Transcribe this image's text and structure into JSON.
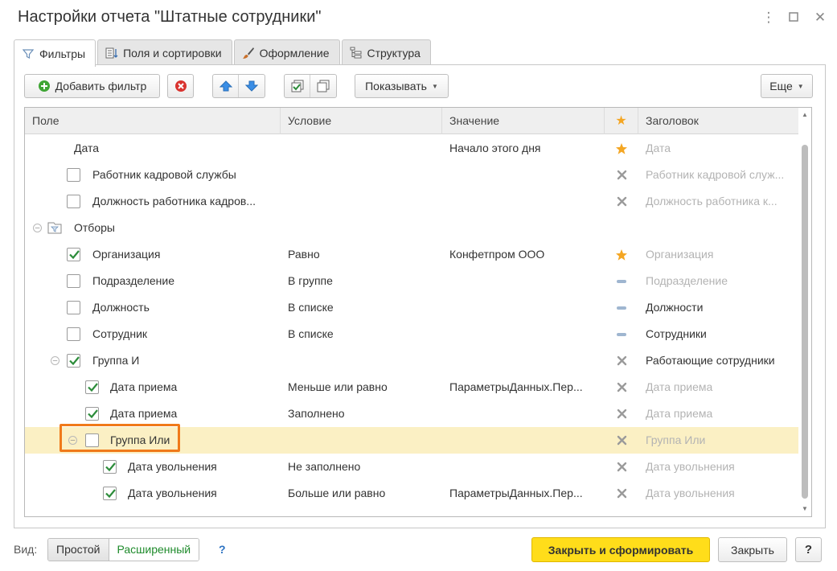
{
  "window": {
    "title": "Настройки отчета \"Штатные сотрудники\""
  },
  "tabs": [
    {
      "label": "Фильтры",
      "icon": "filter-icon",
      "active": true
    },
    {
      "label": "Поля и сортировки",
      "icon": "fields-sort-icon",
      "active": false
    },
    {
      "label": "Оформление",
      "icon": "brush-icon",
      "active": false
    },
    {
      "label": "Структура",
      "icon": "structure-icon",
      "active": false
    }
  ],
  "toolbar": {
    "add_filter_label": "Добавить фильтр",
    "show_label": "Показывать",
    "more_label": "Еще"
  },
  "grid": {
    "headers": {
      "field": "Поле",
      "condition": "Условие",
      "value": "Значение",
      "star": "★",
      "caption": "Заголовок"
    },
    "rows": [
      {
        "field": "Дата",
        "condition": "",
        "value": "Начало этого дня",
        "mark": "star",
        "caption": "Дата",
        "caption_muted": true,
        "checkbox": "none",
        "expander": false
      },
      {
        "field": "Работник кадровой службы",
        "condition": "",
        "value": "",
        "mark": "x",
        "caption": "Работник кадровой служ...",
        "caption_muted": true,
        "checkbox": "unchecked",
        "expander": false
      },
      {
        "field": "Должность работника кадров...",
        "condition": "",
        "value": "",
        "mark": "x",
        "caption": "Должность работника к...",
        "caption_muted": true,
        "checkbox": "unchecked",
        "expander": false
      },
      {
        "field": "Отборы",
        "condition": "",
        "value": "",
        "mark": "",
        "caption": "",
        "caption_muted": false,
        "checkbox": "none",
        "expander": true
      },
      {
        "field": "Организация",
        "condition": "Равно",
        "value": "Конфетпром ООО",
        "mark": "star",
        "caption": "Организация",
        "caption_muted": true,
        "checkbox": "checked",
        "expander": false
      },
      {
        "field": "Подразделение",
        "condition": "В группе",
        "value": "",
        "mark": "dash",
        "caption": "Подразделение",
        "caption_muted": true,
        "checkbox": "unchecked",
        "expander": false
      },
      {
        "field": "Должность",
        "condition": "В списке",
        "value": "",
        "mark": "dash",
        "caption": "Должности",
        "caption_muted": false,
        "checkbox": "unchecked",
        "expander": false
      },
      {
        "field": "Сотрудник",
        "condition": "В списке",
        "value": "",
        "mark": "dash",
        "caption": "Сотрудники",
        "caption_muted": false,
        "checkbox": "unchecked",
        "expander": false
      },
      {
        "field": "Группа И",
        "condition": "",
        "value": "",
        "mark": "x",
        "caption": "Работающие сотрудники",
        "caption_muted": false,
        "checkbox": "checked",
        "expander": true
      },
      {
        "field": "Дата приема",
        "condition": "Меньше или равно",
        "value": "ПараметрыДанных.Пер...",
        "mark": "x",
        "caption": "Дата приема",
        "caption_muted": true,
        "checkbox": "checked",
        "expander": false
      },
      {
        "field": "Дата приема",
        "condition": "Заполнено",
        "value": "",
        "mark": "x",
        "caption": "Дата приема",
        "caption_muted": true,
        "checkbox": "checked",
        "expander": false
      },
      {
        "field": "Группа Или",
        "condition": "",
        "value": "",
        "mark": "x",
        "caption": "Группа Или",
        "caption_muted": true,
        "checkbox": "unchecked",
        "expander": true,
        "selected": true
      },
      {
        "field": "Дата увольнения",
        "condition": "Не заполнено",
        "value": "",
        "mark": "x",
        "caption": "Дата увольнения",
        "caption_muted": true,
        "checkbox": "checked",
        "expander": false
      },
      {
        "field": "Дата увольнения",
        "condition": "Больше или равно",
        "value": "ПараметрыДанных.Пер...",
        "mark": "x",
        "caption": "Дата увольнения",
        "caption_muted": true,
        "checkbox": "checked",
        "expander": false
      }
    ]
  },
  "footer": {
    "view_label": "Вид:",
    "simple_label": "Простой",
    "extended_label": "Расширенный",
    "help_label": "?",
    "generate_label": "Закрыть и сформировать",
    "close_label": "Закрыть",
    "question_label": "?"
  },
  "colors": {
    "primary_button": "#ffdd1a",
    "selected_row": "#fbf0c4",
    "highlight_frame": "#f07a1a",
    "check_green": "#2c8c3a",
    "star_orange": "#f4a623"
  }
}
